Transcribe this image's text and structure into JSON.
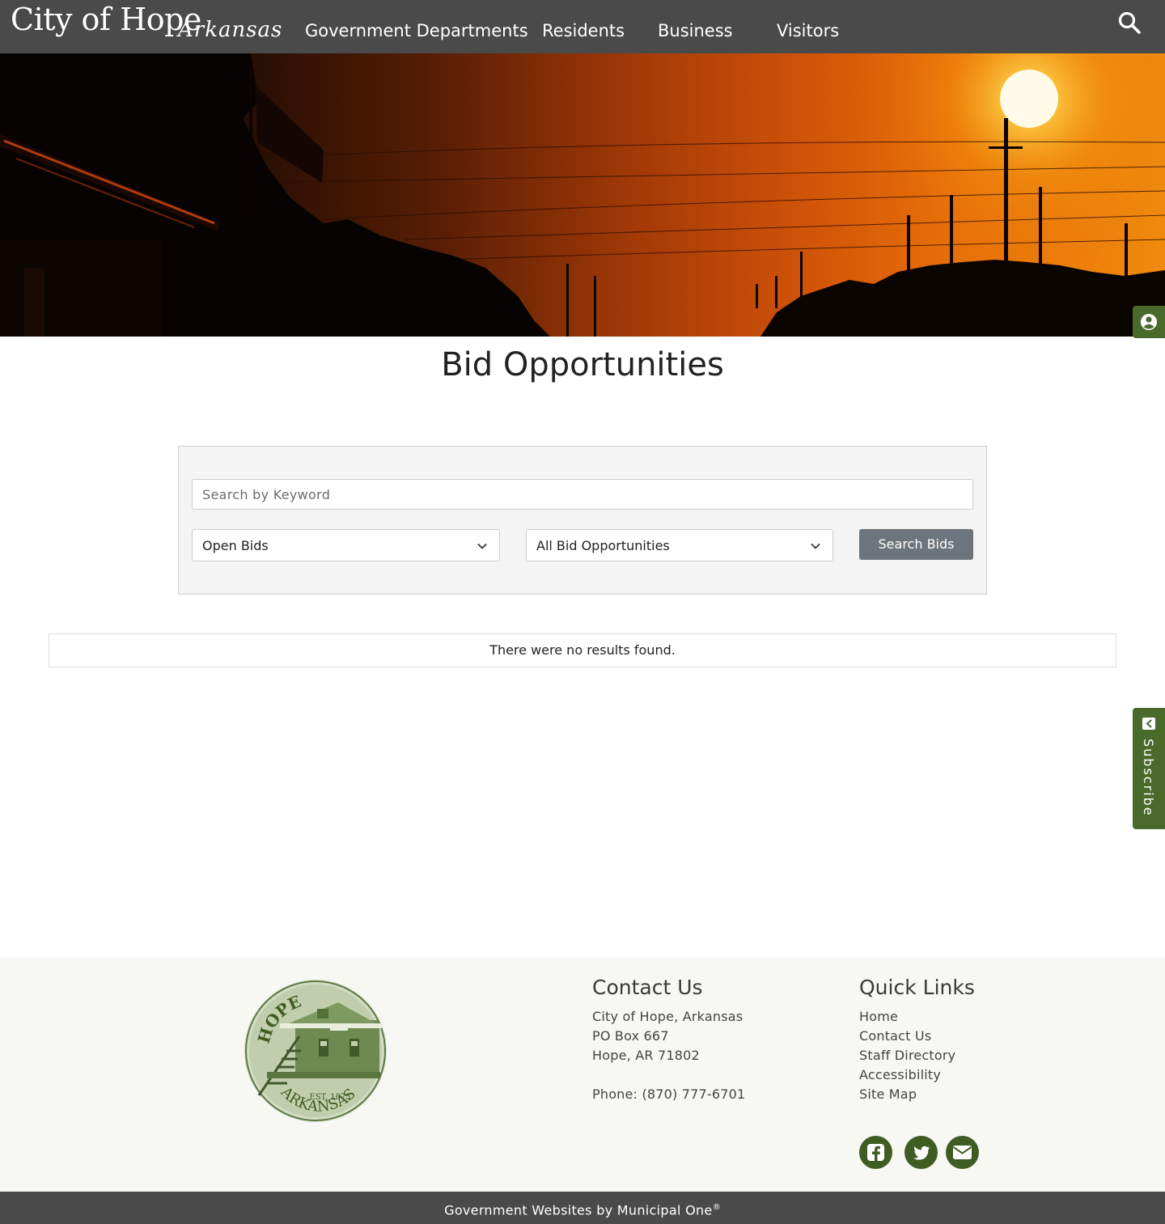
{
  "header": {
    "logo_main": "City of Hope",
    "logo_script": "Arkansas",
    "nav": [
      {
        "label": "Government Departments"
      },
      {
        "label": "Residents"
      },
      {
        "label": "Business"
      },
      {
        "label": "Visitors"
      }
    ]
  },
  "side_tabs": {
    "subscribe_label": "Subscribe"
  },
  "main": {
    "title": "Bid Opportunities",
    "search": {
      "placeholder": "Search by Keyword",
      "status_select": "Open Bids",
      "type_select": "All Bid Opportunities",
      "button_label": "Search Bids"
    },
    "results_message": "There were no results found."
  },
  "footer": {
    "seal": {
      "top_text": "HOPE",
      "bottom_text": "ARKANSAS",
      "est": "EST. 1875"
    },
    "contact": {
      "heading": "Contact Us",
      "lines": [
        "City of Hope, Arkansas",
        "PO Box 667",
        "Hope, AR 71802"
      ],
      "phone": "Phone: (870) 777-6701"
    },
    "quick_links": {
      "heading": "Quick Links",
      "links": [
        {
          "label": "Home"
        },
        {
          "label": "Contact Us"
        },
        {
          "label": "Staff Directory"
        },
        {
          "label": "Accessibility"
        },
        {
          "label": "Site Map"
        }
      ]
    },
    "social": [
      {
        "icon": "facebook-icon"
      },
      {
        "icon": "twitter-icon"
      },
      {
        "icon": "envelope-icon"
      }
    ],
    "credit": "Government Websites by Municipal One",
    "credit_mark": "®"
  },
  "colors": {
    "header_bg": "#4a4a4a",
    "accent_green": "#4a6a2c",
    "social_green": "#3f5d22",
    "button_gray": "#6c757d",
    "footer_bg": "#f7f7f4"
  }
}
